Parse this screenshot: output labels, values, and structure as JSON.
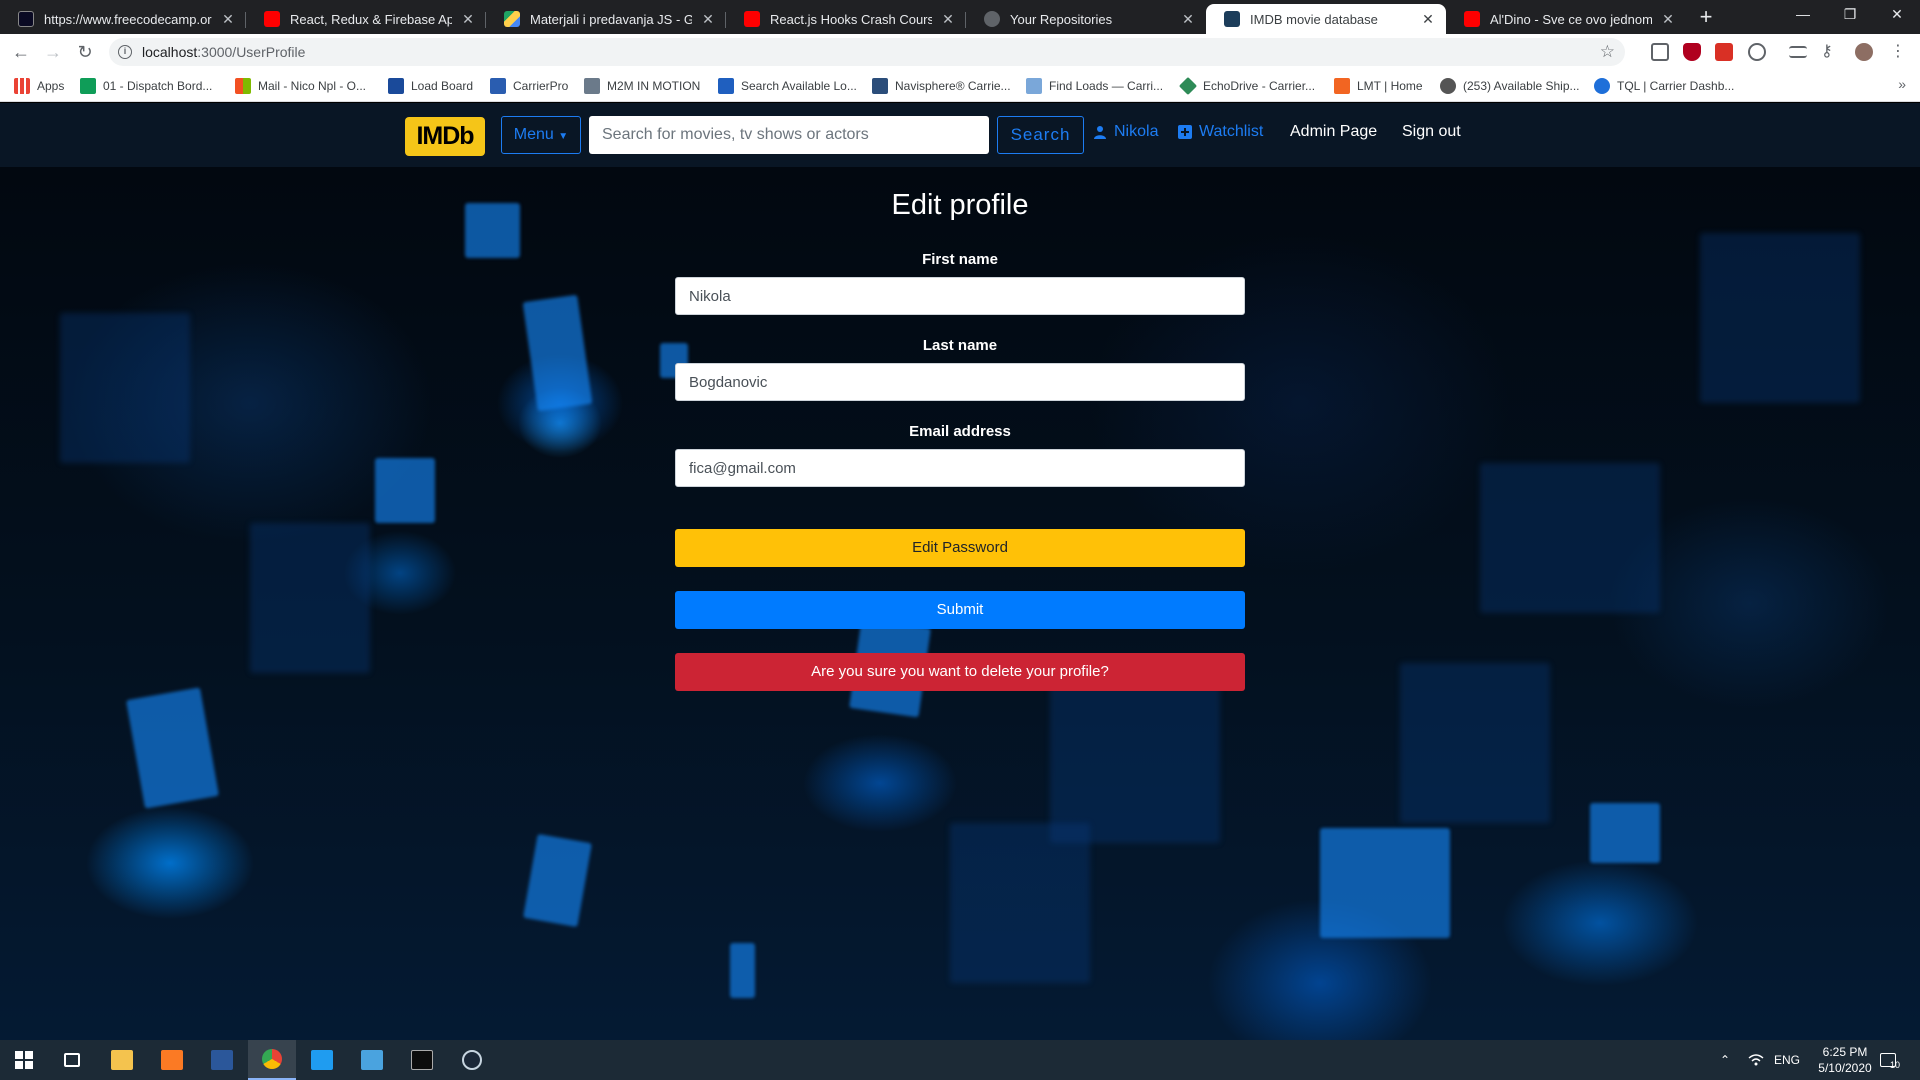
{
  "browser": {
    "tabs": [
      {
        "title": "https://www.freecodecamp.org/l",
        "favicon_color": "#0a0a23"
      },
      {
        "title": "React, Redux & Firebase App Tut",
        "favicon_color": "#ff0000"
      },
      {
        "title": "Materjali i predavanja JS - Googl",
        "favicon_color": "#1fa463"
      },
      {
        "title": "React.js Hooks Crash Course - Yo",
        "favicon_color": "#ff0000"
      },
      {
        "title": "Your Repositories",
        "favicon_color": "#5f6368"
      },
      {
        "title": "IMDB movie database",
        "favicon_color": "#1c3d5a"
      },
      {
        "title": "Al'Dino - Sve ce ovo jednom",
        "favicon_color": "#ff0000"
      }
    ],
    "active_tab_index": 5,
    "new_tab_symbol": "+",
    "window_controls": {
      "minimize": "—",
      "maximize": "❐",
      "close": "✕"
    },
    "url_host": "localhost",
    "url_rest": ":3000/UserProfile",
    "bookmarks": [
      {
        "label": "Apps",
        "icon_color": "#ea4335"
      },
      {
        "label": "01 - Dispatch Bord...",
        "icon_color": "#0f9d58"
      },
      {
        "label": "Mail - Nico Npl - O...",
        "icon_color": "#f25022"
      },
      {
        "label": "Load Board",
        "icon_color": "#1a4a9a"
      },
      {
        "label": "CarrierPro",
        "icon_color": "#2a5db0"
      },
      {
        "label": "M2M IN MOTION",
        "icon_color": "#6b7a8a"
      },
      {
        "label": "Search Available Lo...",
        "icon_color": "#1f5fbf"
      },
      {
        "label": "Navisphere® Carrie...",
        "icon_color": "#2b4d7a"
      },
      {
        "label": "Find Loads — Carri...",
        "icon_color": "#7aa7d9"
      },
      {
        "label": "EchoDrive - Carrier...",
        "icon_color": "#2e8b57"
      },
      {
        "label": "LMT | Home",
        "icon_color": "#f26522"
      },
      {
        "label": "(253) Available Ship...",
        "icon_color": "#555555"
      },
      {
        "label": "TQL | Carrier Dashb...",
        "icon_color": "#1e6fd9"
      }
    ],
    "bookmarks_more": "»"
  },
  "site": {
    "logo_text": "IMDb",
    "menu_label": "Menu",
    "search_placeholder": "Search for movies, tv shows or actors",
    "search_button": "Search",
    "user_link": "Nikola",
    "watchlist_link": "Watchlist",
    "admin_link": "Admin Page",
    "signout_link": "Sign out",
    "accent_color": "#f5c518",
    "link_color": "#1d7cf2"
  },
  "form": {
    "title": "Edit profile",
    "first_name_label": "First name",
    "first_name_value": "Nikola",
    "last_name_label": "Last name",
    "last_name_value": "Bogdanovic",
    "email_label": "Email address",
    "email_value": "fica@gmail.com",
    "edit_password_button": "Edit Password",
    "submit_button": "Submit",
    "delete_button": "Are you sure you want to delete your profile?"
  },
  "taskbar": {
    "language": "ENG",
    "time": "6:25 PM",
    "date": "5/10/2020",
    "notification_count": "10"
  }
}
